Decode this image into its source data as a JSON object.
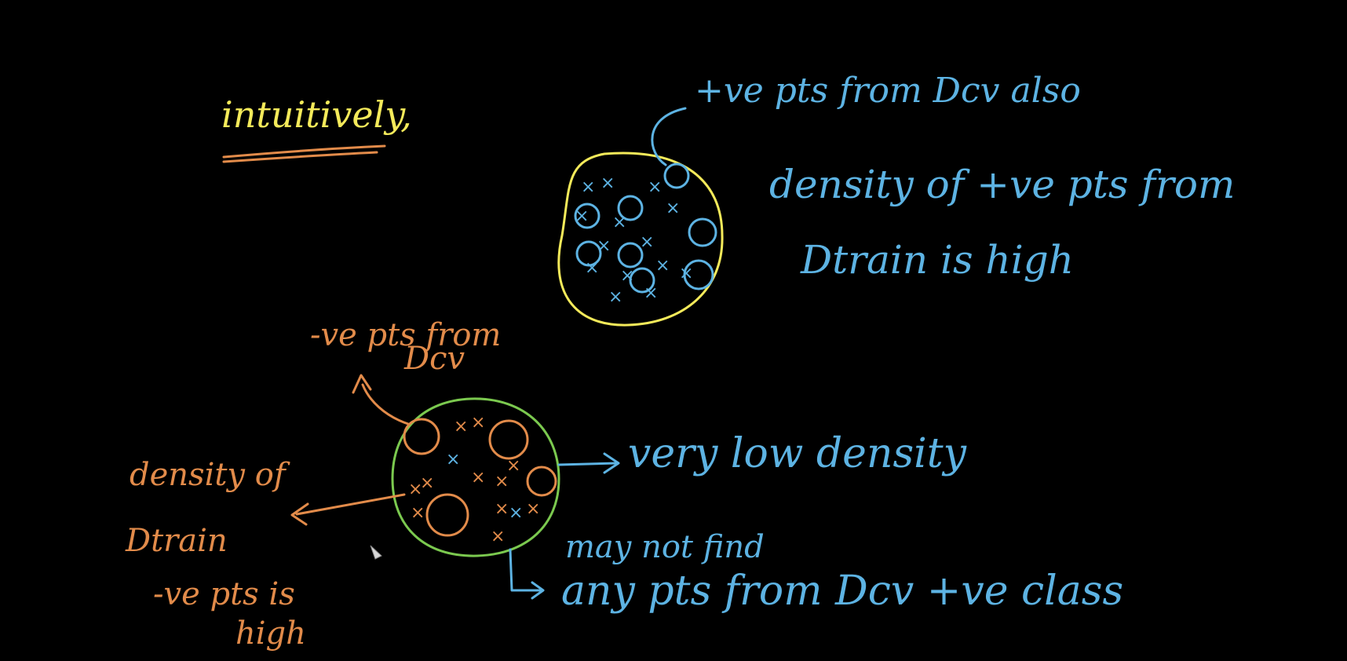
{
  "notes": {
    "title": "intuitively,",
    "pos_points_label": "+ve pts from Dcv also",
    "pos_density_line1": "density of +ve pts from",
    "pos_density_line2": "Dtrain is high",
    "neg_points_label_line1": "-ve pts from",
    "neg_points_label_line2": "Dcv",
    "neg_density_line1": "density of",
    "neg_density_line2": "Dtrain",
    "neg_density_line3": "-ve pts is",
    "neg_density_line4": "high",
    "very_low_density": "very low density",
    "may_not_find": "may not find",
    "any_pts": "any pts from Dcv +ve class"
  },
  "colors": {
    "background": "#000000",
    "yellow": "#f4ea5a",
    "orange": "#e28b4a",
    "blue": "#5db3e3",
    "green": "#7bc94f"
  },
  "cursor": {
    "icon": "pen-cursor-icon"
  }
}
